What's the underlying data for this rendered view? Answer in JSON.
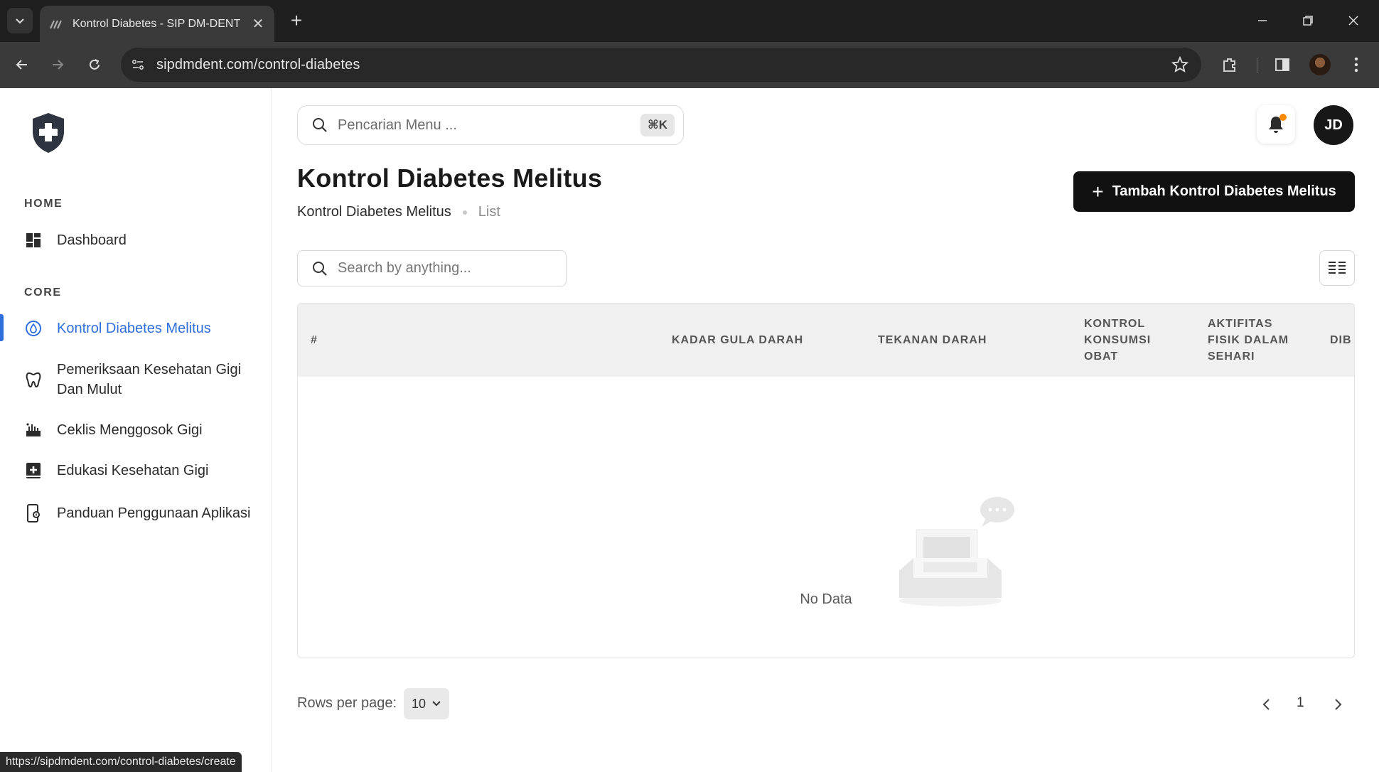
{
  "browser": {
    "tab_title": "Kontrol Diabetes - SIP DM-DENT",
    "url": "sipdmdent.com/control-diabetes",
    "status_url": "https://sipdmdent.com/control-diabetes/create"
  },
  "sidebar": {
    "sections": [
      {
        "label": "HOME"
      },
      {
        "label": "CORE"
      }
    ],
    "items": [
      {
        "label": "Dashboard",
        "icon": "dashboard-icon"
      },
      {
        "label": "Kontrol Diabetes Melitus",
        "icon": "blood-drop-icon",
        "active": true
      },
      {
        "label": "Pemeriksaan Kesehatan Gigi Dan Mulut",
        "icon": "tooth-icon"
      },
      {
        "label": "Ceklis Menggosok Gigi",
        "icon": "checklist-icon"
      },
      {
        "label": "Edukasi Kesehatan Gigi",
        "icon": "book-plus-icon"
      },
      {
        "label": "Panduan Penggunaan Aplikasi",
        "icon": "mobile-guide-icon"
      }
    ]
  },
  "header": {
    "search_placeholder": "Pencarian Menu ...",
    "shortcut": "⌘K",
    "avatar_initials": "JD"
  },
  "page": {
    "title": "Kontrol Diabetes Melitus",
    "breadcrumb": [
      "Kontrol Diabetes Melitus",
      "List"
    ],
    "add_button_label": "Tambah Kontrol Diabetes Melitus"
  },
  "table": {
    "search_placeholder": "Search by anything...",
    "columns": [
      "#",
      "KADAR GULA DARAH",
      "TEKANAN DARAH",
      "KONTROL KONSUMSI OBAT",
      "AKTIFITAS FISIK DALAM SEHARI",
      "DIB"
    ],
    "empty_text": "No Data",
    "rows_per_page_label": "Rows per page:",
    "rows_per_page": "10",
    "current_page": "1"
  },
  "colors": {
    "accent": "#2f6fdd",
    "primary_button": "#111111",
    "notification_dot": "#ff8a00"
  }
}
